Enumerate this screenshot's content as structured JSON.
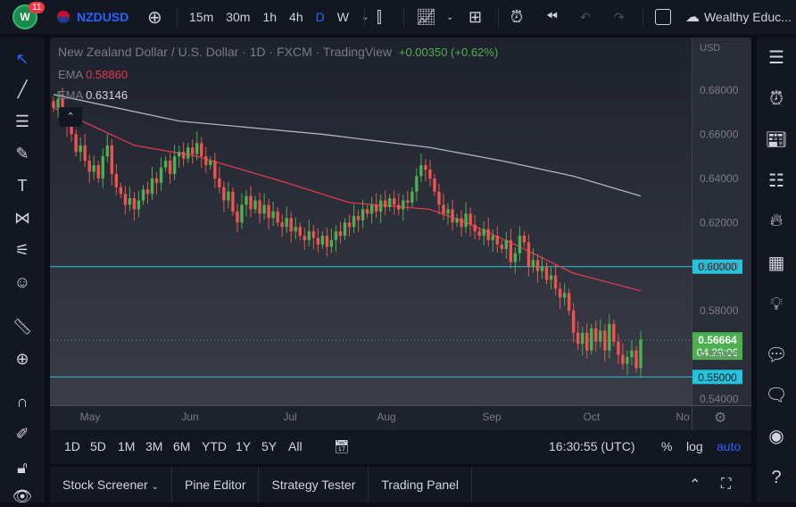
{
  "topbar": {
    "notif_count": "11",
    "symbol": "NZDUSD",
    "intervals": [
      "15m",
      "30m",
      "1h",
      "4h",
      "D",
      "W"
    ],
    "active_interval": "D",
    "account": "Wealthy Educ..."
  },
  "legend": {
    "title": "New Zealand Dollar / U.S. Dollar · 1D · FXCM · TradingView",
    "change": "+0.00350 (+0.62%)",
    "ema1_label": "EMA",
    "ema1_value": "0.58860",
    "ema2_label": "EMA",
    "ema2_value": "0.63146"
  },
  "axis": {
    "currency": "USD",
    "price_ticks": [
      "0.68000",
      "0.66000",
      "0.64000",
      "0.62000",
      "0.60000",
      "0.58000",
      "0.56000",
      "0.54000"
    ],
    "time_ticks": [
      "May",
      "Jun",
      "Jul",
      "Aug",
      "Sep",
      "Oct",
      "No"
    ]
  },
  "price_labels": {
    "level_high": "0.60000",
    "level_low": "0.55000",
    "last_price": "0.56664",
    "countdown": "04:29:06"
  },
  "range_bar": {
    "ranges": [
      "1D",
      "5D",
      "1M",
      "3M",
      "6M",
      "YTD",
      "1Y",
      "5Y",
      "All"
    ],
    "clock": "16:30:55 (UTC)",
    "percent": "%",
    "log": "log",
    "auto": "auto"
  },
  "bottom_tabs": [
    "Stock Screener",
    "Pine Editor",
    "Strategy Tester",
    "Trading Panel"
  ],
  "colors": {
    "up": "#26a69a",
    "down": "#ef5350",
    "ema_fast": "#e0394f",
    "ema_slow": "#b2b5be",
    "level": "#22c3dc",
    "accent": "#2962ff"
  },
  "chart_data": {
    "type": "candlestick",
    "symbol": "NZDUSD",
    "ylim": [
      0.54,
      0.68
    ],
    "closes": [
      0.672,
      0.676,
      0.668,
      0.664,
      0.66,
      0.652,
      0.655,
      0.648,
      0.643,
      0.646,
      0.64,
      0.65,
      0.655,
      0.642,
      0.636,
      0.633,
      0.628,
      0.631,
      0.626,
      0.63,
      0.635,
      0.633,
      0.64,
      0.638,
      0.645,
      0.648,
      0.642,
      0.65,
      0.652,
      0.649,
      0.654,
      0.651,
      0.656,
      0.65,
      0.646,
      0.648,
      0.64,
      0.636,
      0.63,
      0.634,
      0.625,
      0.62,
      0.628,
      0.632,
      0.626,
      0.63,
      0.624,
      0.628,
      0.622,
      0.625,
      0.62,
      0.618,
      0.622,
      0.616,
      0.618,
      0.614,
      0.612,
      0.616,
      0.613,
      0.61,
      0.614,
      0.609,
      0.612,
      0.616,
      0.614,
      0.62,
      0.618,
      0.623,
      0.621,
      0.626,
      0.624,
      0.628,
      0.625,
      0.63,
      0.627,
      0.631,
      0.628,
      0.626,
      0.63,
      0.629,
      0.634,
      0.641,
      0.646,
      0.644,
      0.64,
      0.634,
      0.628,
      0.624,
      0.626,
      0.62,
      0.622,
      0.618,
      0.624,
      0.619,
      0.616,
      0.614,
      0.617,
      0.612,
      0.614,
      0.61,
      0.608,
      0.612,
      0.602,
      0.606,
      0.614,
      0.611,
      0.6,
      0.603,
      0.598,
      0.6,
      0.594,
      0.596,
      0.59,
      0.586,
      0.588,
      0.58,
      0.57,
      0.565,
      0.57,
      0.562,
      0.572,
      0.566,
      0.571,
      0.562,
      0.574,
      0.566,
      0.56,
      0.556,
      0.559,
      0.562,
      0.554,
      0.567
    ],
    "ema_fast": [
      [
        0,
        0.672
      ],
      [
        18,
        0.655
      ],
      [
        32,
        0.65
      ],
      [
        52,
        0.638
      ],
      [
        66,
        0.629
      ],
      [
        84,
        0.626
      ],
      [
        92,
        0.62
      ],
      [
        104,
        0.609
      ],
      [
        116,
        0.597
      ],
      [
        131,
        0.589
      ]
    ],
    "ema_slow": [
      [
        0,
        0.678
      ],
      [
        28,
        0.666
      ],
      [
        60,
        0.66
      ],
      [
        84,
        0.654
      ],
      [
        100,
        0.648
      ],
      [
        116,
        0.641
      ],
      [
        131,
        0.632
      ]
    ],
    "levels": [
      0.6,
      0.55
    ],
    "last": 0.56664
  }
}
